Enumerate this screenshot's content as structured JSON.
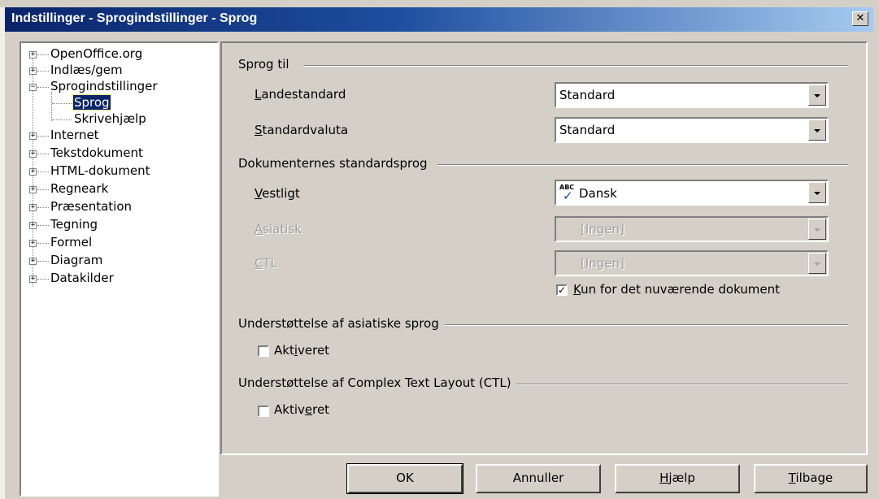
{
  "window": {
    "title": "Indstillinger - Sprogindstillinger - Sprog",
    "close_glyph": "✕"
  },
  "tree": {
    "items": [
      {
        "label": "OpenOffice.org",
        "expander": "+"
      },
      {
        "label": "Indlæs/gem",
        "expander": "+"
      },
      {
        "label": "Sprogindstillinger",
        "expander": "−"
      },
      {
        "label": "Sprog",
        "selected": true
      },
      {
        "label": "Skrivehjælp"
      },
      {
        "label": "Internet",
        "expander": "+"
      },
      {
        "label": "Tekstdokument",
        "expander": "+"
      },
      {
        "label": "HTML-dokument",
        "expander": "+"
      },
      {
        "label": "Regneark",
        "expander": "+"
      },
      {
        "label": "Præsentation",
        "expander": "+"
      },
      {
        "label": "Tegning",
        "expander": "+"
      },
      {
        "label": "Formel",
        "expander": "+"
      },
      {
        "label": "Diagram",
        "expander": "+"
      },
      {
        "label": "Datakilder",
        "expander": "+"
      }
    ]
  },
  "language_for": {
    "group_title": "Sprog til",
    "locale_label_u": "L",
    "locale_label_rest": "andestandard",
    "locale_value": "Standard",
    "currency_label_u": "S",
    "currency_label_rest": "tandardvaluta",
    "currency_value": "Standard"
  },
  "default_languages": {
    "group_title": "Dokumenternes standardsprog",
    "western_label_u": "V",
    "western_label_rest": "estligt",
    "western_value": "Dansk",
    "western_icon": "spellcheck-abc-icon",
    "western_icon_text": "ABC",
    "western_icon_check": "✓",
    "asian_label_u": "A",
    "asian_label_rest": "siatisk",
    "asian_value": "[Ingen]",
    "ctl_label_u": "C",
    "ctl_label_rest": "TL",
    "ctl_value": "[Ingen]",
    "current_doc_checked": true,
    "current_doc_check_glyph": "✓",
    "current_doc_label_u": "K",
    "current_doc_label_rest": "un for det nuværende dokument"
  },
  "asian_support": {
    "group_title": "Understøttelse af asiatiske sprog",
    "enabled_checked": false,
    "enabled_label_a": "Akt",
    "enabled_label_u": "i",
    "enabled_label_b": "veret"
  },
  "ctl_support": {
    "group_title": "Understøttelse af Complex Text Layout (CTL)",
    "enabled_checked": false,
    "enabled_label_a": "Aktiv",
    "enabled_label_u": "e",
    "enabled_label_b": "ret"
  },
  "buttons": {
    "ok": "OK",
    "cancel": "Annuller",
    "help_u": "H",
    "help_rest": "jælp",
    "back_u": "T",
    "back_rest": "ilbage"
  }
}
